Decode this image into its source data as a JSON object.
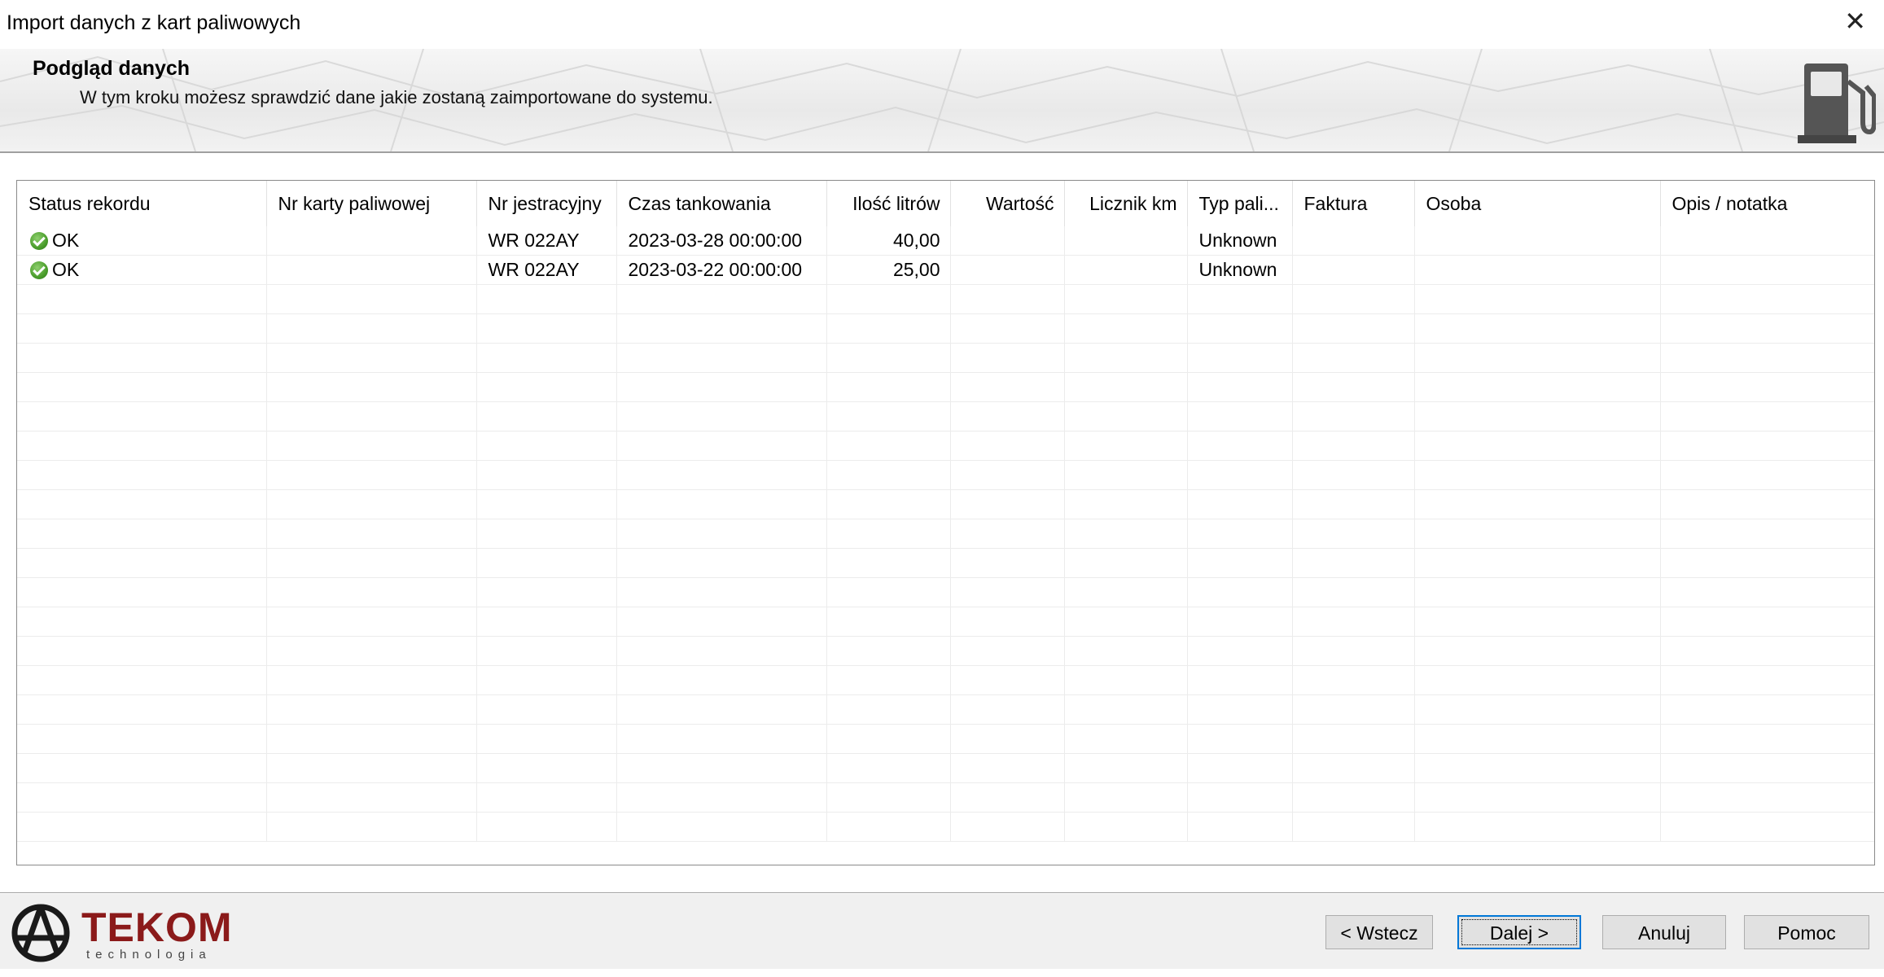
{
  "window": {
    "title": "Import danych z kart paliwowych",
    "close": "✕"
  },
  "banner": {
    "heading": "Podgląd danych",
    "subtitle": "W tym kroku możesz sprawdzić dane jakie zostaną zaimportowane do systemu."
  },
  "grid": {
    "columns": [
      "Status rekordu",
      "Nr karty paliwowej",
      "Nr jestracyjny",
      "Czas tankowania",
      "Ilość litrów",
      "Wartość",
      "Licznik km",
      "Typ pali...",
      "Faktura",
      "Osoba",
      "Opis / notatka"
    ],
    "rows": [
      {
        "status": "OK",
        "card": "",
        "reg": "WR 022AY",
        "time": "2023-03-28 00:00:00",
        "liters": "40,00",
        "value": "",
        "km": "",
        "fuel": "Unknown",
        "invoice": "",
        "person": "",
        "note": ""
      },
      {
        "status": "OK",
        "card": "",
        "reg": "WR 022AY",
        "time": "2023-03-22 00:00:00",
        "liters": "25,00",
        "value": "",
        "km": "",
        "fuel": "Unknown",
        "invoice": "",
        "person": "",
        "note": ""
      }
    ]
  },
  "footer": {
    "logo_word": "TEKOM",
    "logo_tag": "technologia",
    "back": "< Wstecz",
    "next": "Dalej >",
    "cancel": "Anuluj",
    "help": "Pomoc"
  },
  "colors": {
    "brand": "#8b1a1a",
    "ok": "#4a9d2b",
    "focus": "#0078d7"
  },
  "icons": {
    "ok": "check-circle-icon",
    "pump": "fuel-pump-icon",
    "logo": "tekom-logo-icon"
  }
}
